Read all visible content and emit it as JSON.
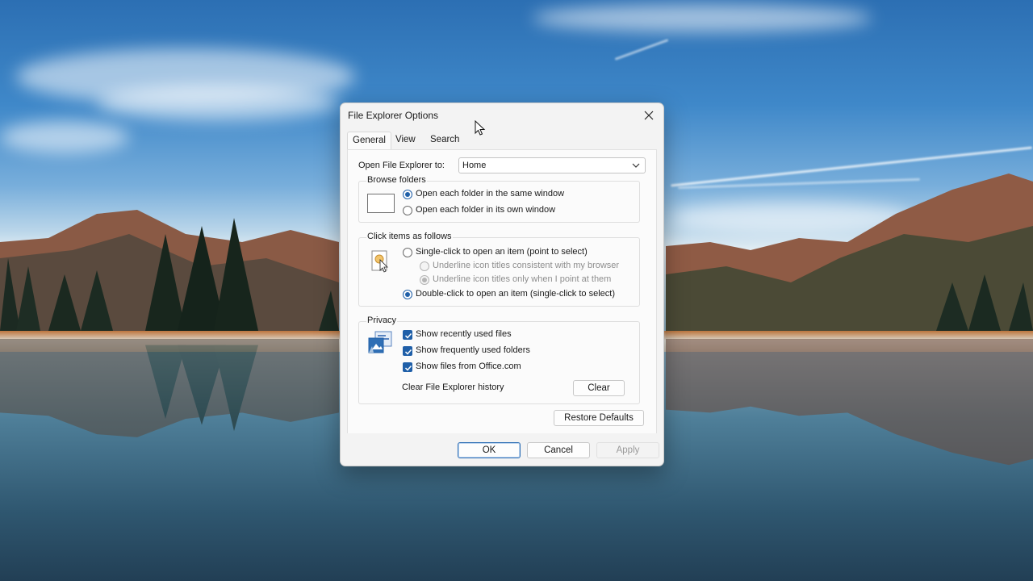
{
  "dialog": {
    "title": "File Explorer Options",
    "close_icon": "close-icon"
  },
  "tabs": [
    {
      "label": "General",
      "active": true
    },
    {
      "label": "View",
      "active": false
    },
    {
      "label": "Search",
      "active": false
    }
  ],
  "general": {
    "open_label": "Open File Explorer to:",
    "open_value": "Home",
    "browse_folders": {
      "title": "Browse folders",
      "icon": "folder-window-icon",
      "options": [
        {
          "label": "Open each folder in the same window",
          "checked": true
        },
        {
          "label": "Open each folder in its own window",
          "checked": false
        }
      ]
    },
    "click_items": {
      "title": "Click items as follows",
      "icon": "pointer-click-icon",
      "single_click": {
        "label": "Single-click to open an item (point to select)",
        "checked": false
      },
      "underline_browser": {
        "label": "Underline icon titles consistent with my browser",
        "checked": false,
        "disabled": true
      },
      "underline_point": {
        "label": "Underline icon titles only when I point at them",
        "checked": true,
        "disabled": true
      },
      "double_click": {
        "label": "Double-click to open an item (single-click to select)",
        "checked": true
      }
    },
    "privacy": {
      "title": "Privacy",
      "icon": "privacy-icon",
      "options": [
        {
          "label": "Show recently used files",
          "checked": true
        },
        {
          "label": "Show frequently used folders",
          "checked": true
        },
        {
          "label": "Show files from Office.com",
          "checked": true
        }
      ],
      "clear_label": "Clear File Explorer history",
      "clear_button": "Clear"
    },
    "restore_defaults": "Restore Defaults"
  },
  "footer": {
    "ok": "OK",
    "cancel": "Cancel",
    "apply": "Apply"
  },
  "colors": {
    "accent": "#1f5fa8",
    "dialog_bg": "#f3f3f3"
  }
}
